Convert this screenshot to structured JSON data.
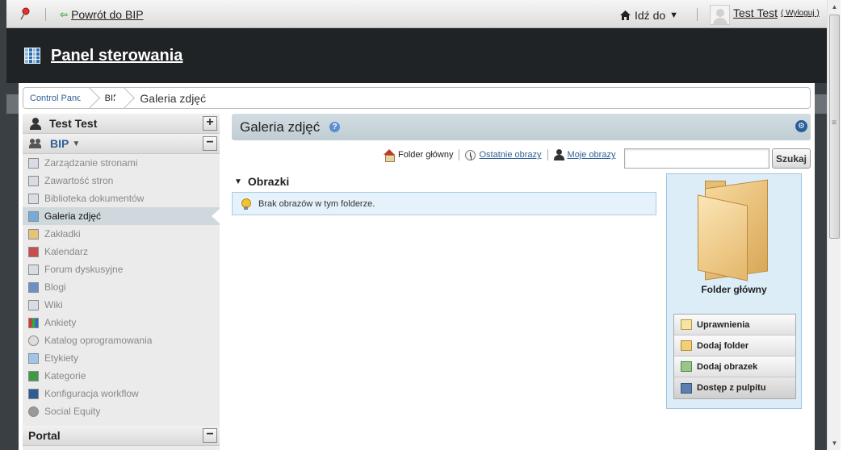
{
  "dockbar": {
    "back_label": "Powrót do BIP",
    "goto_label": "Idź do",
    "user_name": "Test Test",
    "logout_label": "( Wyloguj )"
  },
  "header": {
    "title": "Panel sterowania"
  },
  "breadcrumb": [
    "Control Panel",
    "BIP",
    "Galeria zdjęć"
  ],
  "sidebar": {
    "user_panel": "Test Test",
    "site_panel": "BIP",
    "items": [
      {
        "label": "Zarządzanie stronami",
        "icon": "pages-icon"
      },
      {
        "label": "Zawartość stron",
        "icon": "web-content-icon"
      },
      {
        "label": "Biblioteka dokumentów",
        "icon": "document-library-icon"
      },
      {
        "label": "Galeria zdjęć",
        "icon": "image-gallery-icon",
        "selected": true
      },
      {
        "label": "Zakładki",
        "icon": "bookmarks-icon"
      },
      {
        "label": "Kalendarz",
        "icon": "calendar-icon"
      },
      {
        "label": "Forum dyskusyjne",
        "icon": "message-boards-icon"
      },
      {
        "label": "Blogi",
        "icon": "blogs-icon"
      },
      {
        "label": "Wiki",
        "icon": "wiki-icon"
      },
      {
        "label": "Ankiety",
        "icon": "polls-icon"
      },
      {
        "label": "Katalog oprogramowania",
        "icon": "software-catalog-icon"
      },
      {
        "label": "Etykiety",
        "icon": "tags-icon"
      },
      {
        "label": "Kategorie",
        "icon": "categories-icon"
      },
      {
        "label": "Konfiguracja workflow",
        "icon": "workflow-icon"
      },
      {
        "label": "Social Equity",
        "icon": "social-equity-icon"
      }
    ],
    "portal_panel": "Portal"
  },
  "main": {
    "title": "Galeria zdjęć",
    "toolbar": {
      "root_folder": "Folder główny",
      "recent_images": "Ostatnie obrazy",
      "my_images": "Moje obrazy"
    },
    "search": {
      "value": "",
      "button": "Szukaj"
    },
    "section_title": "Obrazki",
    "info_message": "Brak obrazów w tym folderze.",
    "folder_panel": {
      "folder_name": "Folder główny",
      "actions": [
        "Uprawnienia",
        "Dodaj folder",
        "Dodaj obrazek",
        "Dostęp z pulpitu"
      ]
    }
  }
}
